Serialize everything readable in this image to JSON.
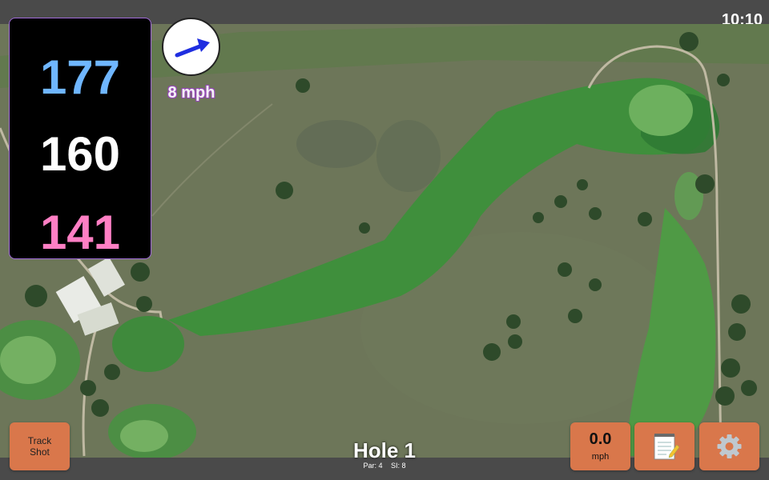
{
  "status": {
    "time": "10:10"
  },
  "distances": {
    "back": "177",
    "middle": "160",
    "front": "141"
  },
  "wind": {
    "speed_label": "8 mph",
    "icon": "arrow-icon"
  },
  "buttons": {
    "track_shot_line1": "Track",
    "track_shot_line2": "Shot",
    "wind_value": "0.0",
    "wind_unit": "mph",
    "notes_icon": "notepad-icon",
    "settings_icon": "gear-icon"
  },
  "hole": {
    "title": "Hole 1",
    "par": "Par: 4",
    "si": "SI: 8"
  },
  "colors": {
    "button": "#d9774b",
    "back": "#6fb6ff",
    "front": "#ff7fc4",
    "fairway": "#3f8f3c",
    "rough": "#6f7a5a"
  }
}
